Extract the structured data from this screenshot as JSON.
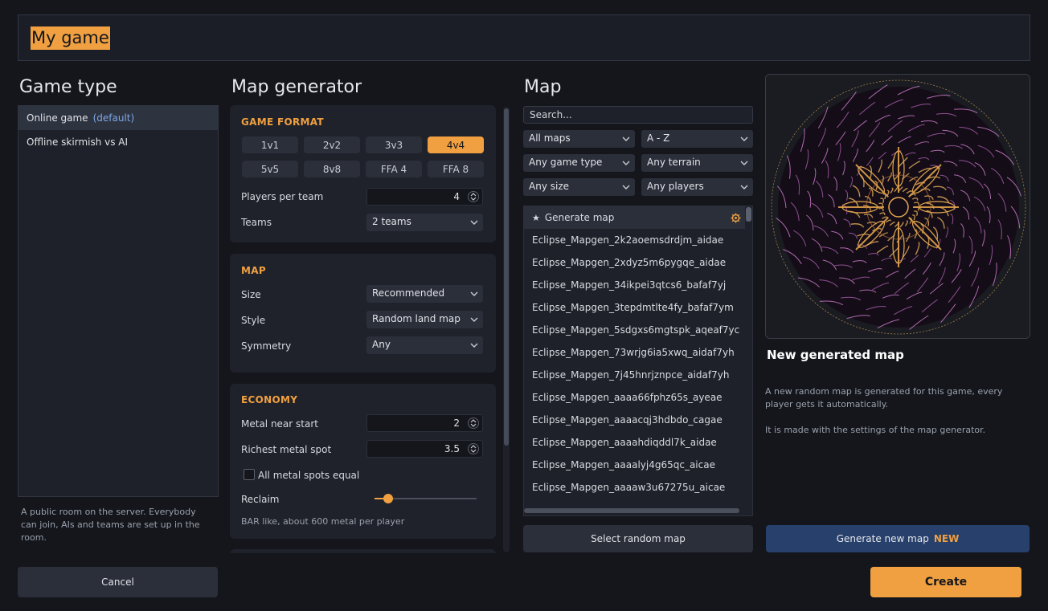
{
  "game_name": "My game",
  "game_type": {
    "title": "Game type",
    "items": [
      {
        "label": "Online game",
        "suffix": "(default)"
      },
      {
        "label": "Offline skirmish vs AI",
        "suffix": ""
      }
    ],
    "description": "A public room on the server. Everybody can join, AIs and teams are set up in the room."
  },
  "map_generator": {
    "title": "Map generator",
    "game_format": {
      "title": "GAME FORMAT",
      "options": [
        "1v1",
        "2v2",
        "3v3",
        "4v4",
        "5v5",
        "8v8",
        "FFA 4",
        "FFA 8"
      ],
      "selected": "4v4",
      "players_per_team_label": "Players per team",
      "players_per_team_value": "4",
      "teams_label": "Teams",
      "teams_value": "2 teams"
    },
    "map": {
      "title": "MAP",
      "size_label": "Size",
      "size_value": "Recommended",
      "style_label": "Style",
      "style_value": "Random land map",
      "symmetry_label": "Symmetry",
      "symmetry_value": "Any"
    },
    "economy": {
      "title": "ECONOMY",
      "metal_near_start_label": "Metal near start",
      "metal_near_start_value": "2",
      "richest_metal_label": "Richest metal spot",
      "richest_metal_value": "3.5",
      "all_equal_label": "All metal spots equal",
      "reclaim_label": "Reclaim",
      "reclaim_level": 0.13,
      "reclaim_desc": "BAR like, about 600 metal per player"
    }
  },
  "map": {
    "title": "Map",
    "search_placeholder": "Search...",
    "filters": {
      "maps": "All maps",
      "sort": "A - Z",
      "game_type": "Any game type",
      "terrain": "Any terrain",
      "size": "Any size",
      "players": "Any players"
    },
    "generate_row": "Generate map",
    "list": [
      "Eclipse_Mapgen_2k2aoemsdrdjm_aidae",
      "Eclipse_Mapgen_2xdyz5m6pygqe_aidae",
      "Eclipse_Mapgen_34ikpei3qtcs6_bafaf7yj",
      "Eclipse_Mapgen_3tepdmtlte4fy_bafaf7ym",
      "Eclipse_Mapgen_5sdgxs6mgtspk_aqeaf7yc",
      "Eclipse_Mapgen_73wrjg6ia5xwq_aidaf7yh",
      "Eclipse_Mapgen_7j45hnrjznpce_aidaf7yh",
      "Eclipse_Mapgen_aaaa66fphz65s_ayeae",
      "Eclipse_Mapgen_aaaacqj3hdbdo_cagae",
      "Eclipse_Mapgen_aaaahdiqddl7k_aidae",
      "Eclipse_Mapgen_aaaalyj4g65qc_aicae",
      "Eclipse_Mapgen_aaaaw3u67275u_aicae"
    ],
    "random_button": "Select random map"
  },
  "preview": {
    "title": "New generated map",
    "desc1": "A new random map is generated for this game, every player gets it automatically.",
    "desc2": "It is made with the settings of the map generator.",
    "generate_button": "Generate new map",
    "generate_badge": "NEW"
  },
  "cancel_button": "Cancel",
  "create_button": "Create",
  "colors": {
    "accent": "#f0a040",
    "background": "#14161c",
    "panel": "#1f222b",
    "blue_button": "#27406c",
    "link": "#7ea7e6"
  }
}
